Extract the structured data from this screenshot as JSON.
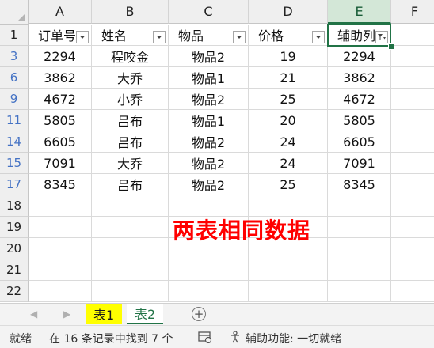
{
  "grid": {
    "column_headers": [
      "A",
      "B",
      "C",
      "D",
      "E",
      "F"
    ],
    "row_headers": [
      "1",
      "3",
      "6",
      "9",
      "11",
      "14",
      "15",
      "17",
      "18",
      "19",
      "20",
      "21",
      "22"
    ],
    "header_row": [
      "订单号",
      "姓名",
      "物品",
      "价格",
      "辅助列"
    ],
    "rows": [
      [
        "2294",
        "程咬金",
        "物品2",
        "19",
        "2294"
      ],
      [
        "3862",
        "大乔",
        "物品1",
        "21",
        "3862"
      ],
      [
        "4672",
        "小乔",
        "物品2",
        "25",
        "4672"
      ],
      [
        "5805",
        "吕布",
        "物品1",
        "20",
        "5805"
      ],
      [
        "6605",
        "吕布",
        "物品2",
        "24",
        "6605"
      ],
      [
        "7091",
        "大乔",
        "物品2",
        "24",
        "7091"
      ],
      [
        "8345",
        "吕布",
        "物品2",
        "25",
        "8345"
      ]
    ],
    "selected_column": "E",
    "filtered_column": "E"
  },
  "annotation": "两表相同数据",
  "sheet_tabs": {
    "tabs": [
      "表1",
      "表2"
    ],
    "active": "表2",
    "highlight_color": "#ffff00",
    "nav_left": "◀",
    "nav_right": "▶",
    "add_label": "+"
  },
  "status_bar": {
    "mode": "就绪",
    "filter_result": "在 16 条记录中找到 7 个",
    "accessibility": "辅助功能: 一切就绪"
  },
  "colors": {
    "accent": "#217346",
    "row_number_filtered": "#4472c4",
    "annotation": "#ff0000"
  }
}
